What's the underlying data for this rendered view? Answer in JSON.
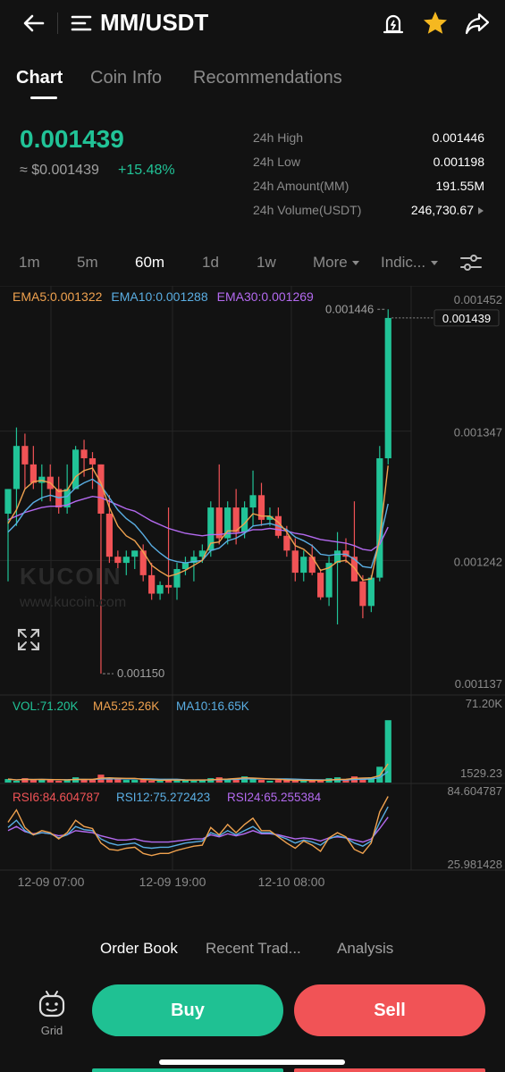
{
  "header": {
    "title": "MM/USDT"
  },
  "tabs": [
    {
      "label": "Chart",
      "active": true
    },
    {
      "label": "Coin Info",
      "active": false
    },
    {
      "label": "Recommendations",
      "active": false
    }
  ],
  "ticker": {
    "last_price": "0.001439",
    "usd_price": "≈ $0.001439",
    "change": "+15.48%",
    "stats": [
      {
        "label": "24h High",
        "value": "0.001446"
      },
      {
        "label": "24h Low",
        "value": "0.001198"
      },
      {
        "label": "24h Amount(MM)",
        "value": "191.55M"
      },
      {
        "label": "24h Volume(USDT)",
        "value": "246,730.67"
      }
    ]
  },
  "intervals": [
    {
      "label": "1m",
      "active": false
    },
    {
      "label": "5m",
      "active": false
    },
    {
      "label": "60m",
      "active": true
    },
    {
      "label": "1d",
      "active": false
    },
    {
      "label": "1w",
      "active": false
    },
    {
      "label": "More",
      "active": false
    },
    {
      "label": "Indic...",
      "active": false
    }
  ],
  "legend": {
    "ema5": "EMA5:0.001322",
    "ema10": "EMA10:0.001288",
    "ema30": "EMA30:0.001269",
    "vol": "VOL:71.20K",
    "ma5": "MA5:25.26K",
    "ma10": "MA10:16.65K",
    "rsi6": "RSI6:84.604787",
    "rsi12": "RSI12:75.272423",
    "rsi24": "RSI24:65.255384"
  },
  "watermark": {
    "brand": "KUCOIN",
    "url": "www.kucoin.com"
  },
  "bottom_tabs": [
    {
      "label": "Order Book",
      "active": true
    },
    {
      "label": "Recent Trad...",
      "active": false
    },
    {
      "label": "Analysis",
      "active": false
    }
  ],
  "actions": {
    "grid_label": "Grid",
    "buy": "Buy",
    "sell": "Sell"
  },
  "colors": {
    "up": "#21c397",
    "down": "#f15356",
    "ema5": "#f0a24f",
    "ema10": "#5aaee3",
    "ema30": "#b46af0"
  },
  "chart_data": {
    "type": "candlestick",
    "price_axis_ticks": [
      "0.001452",
      "0.001347",
      "0.001242",
      "0.001137"
    ],
    "price_range": [
      0.001137,
      0.001452
    ],
    "current_price_label": "0.001439",
    "high_marker": "0.001446",
    "low_marker": "0.001150",
    "volume_axis_ticks": [
      "71.20K",
      "1529.23"
    ],
    "volume_range": [
      1529.23,
      71200
    ],
    "rsi_axis_ticks": [
      "84.604787",
      "25.981428"
    ],
    "rsi_range": [
      25.981428,
      84.604787
    ],
    "time_labels": [
      "12-09 07:00",
      "12-09 19:00",
      "12-10 08:00"
    ],
    "candles": [
      {
        "o": 0.00128,
        "h": 0.0013,
        "l": 0.001225,
        "c": 0.0013
      },
      {
        "o": 0.0013,
        "h": 0.00135,
        "l": 0.00127,
        "c": 0.001335
      },
      {
        "o": 0.001335,
        "h": 0.001345,
        "l": 0.0013,
        "c": 0.00132
      },
      {
        "o": 0.00132,
        "h": 0.001335,
        "l": 0.0013,
        "c": 0.001305
      },
      {
        "o": 0.001305,
        "h": 0.00132,
        "l": 0.00129,
        "c": 0.00131
      },
      {
        "o": 0.00131,
        "h": 0.00132,
        "l": 0.00129,
        "c": 0.0013
      },
      {
        "o": 0.0013,
        "h": 0.00131,
        "l": 0.00128,
        "c": 0.001285
      },
      {
        "o": 0.001285,
        "h": 0.00132,
        "l": 0.00128,
        "c": 0.0013
      },
      {
        "o": 0.0013,
        "h": 0.001335,
        "l": 0.0013,
        "c": 0.001332
      },
      {
        "o": 0.001332,
        "h": 0.00134,
        "l": 0.00131,
        "c": 0.001325
      },
      {
        "o": 0.001325,
        "h": 0.00133,
        "l": 0.0013,
        "c": 0.00132
      },
      {
        "o": 0.00132,
        "h": 0.00132,
        "l": 0.00115,
        "c": 0.00128
      },
      {
        "o": 0.00128,
        "h": 0.001295,
        "l": 0.00124,
        "c": 0.001245
      },
      {
        "o": 0.001245,
        "h": 0.00125,
        "l": 0.001225,
        "c": 0.00124
      },
      {
        "o": 0.00124,
        "h": 0.00125,
        "l": 0.00123,
        "c": 0.001245
      },
      {
        "o": 0.001245,
        "h": 0.00125,
        "l": 0.001235,
        "c": 0.00125
      },
      {
        "o": 0.00125,
        "h": 0.001255,
        "l": 0.001225,
        "c": 0.00123
      },
      {
        "o": 0.00123,
        "h": 0.00124,
        "l": 0.00121,
        "c": 0.001215
      },
      {
        "o": 0.001215,
        "h": 0.001225,
        "l": 0.00121,
        "c": 0.001222
      },
      {
        "o": 0.001222,
        "h": 0.001285,
        "l": 0.001215,
        "c": 0.00122
      },
      {
        "o": 0.00122,
        "h": 0.00124,
        "l": 0.00121,
        "c": 0.001235
      },
      {
        "o": 0.001235,
        "h": 0.001245,
        "l": 0.00123,
        "c": 0.00124
      },
      {
        "o": 0.00124,
        "h": 0.00125,
        "l": 0.001225,
        "c": 0.001245
      },
      {
        "o": 0.001245,
        "h": 0.001255,
        "l": 0.00124,
        "c": 0.00125
      },
      {
        "o": 0.00125,
        "h": 0.00129,
        "l": 0.001245,
        "c": 0.001285
      },
      {
        "o": 0.001285,
        "h": 0.00132,
        "l": 0.001255,
        "c": 0.00126
      },
      {
        "o": 0.00126,
        "h": 0.00129,
        "l": 0.001255,
        "c": 0.001285
      },
      {
        "o": 0.001285,
        "h": 0.0013,
        "l": 0.001255,
        "c": 0.001265
      },
      {
        "o": 0.001265,
        "h": 0.00129,
        "l": 0.00126,
        "c": 0.001285
      },
      {
        "o": 0.001285,
        "h": 0.001315,
        "l": 0.00127,
        "c": 0.001295
      },
      {
        "o": 0.001295,
        "h": 0.001305,
        "l": 0.00127,
        "c": 0.001275
      },
      {
        "o": 0.001275,
        "h": 0.001285,
        "l": 0.00127,
        "c": 0.001278
      },
      {
        "o": 0.001278,
        "h": 0.001285,
        "l": 0.00126,
        "c": 0.001262
      },
      {
        "o": 0.001262,
        "h": 0.00127,
        "l": 0.001245,
        "c": 0.00125
      },
      {
        "o": 0.00125,
        "h": 0.00126,
        "l": 0.001225,
        "c": 0.001232
      },
      {
        "o": 0.001232,
        "h": 0.00125,
        "l": 0.001225,
        "c": 0.001245
      },
      {
        "o": 0.001245,
        "h": 0.001255,
        "l": 0.00123,
        "c": 0.001232
      },
      {
        "o": 0.001232,
        "h": 0.001235,
        "l": 0.00121,
        "c": 0.001212
      },
      {
        "o": 0.001212,
        "h": 0.001245,
        "l": 0.001205,
        "c": 0.00124
      },
      {
        "o": 0.00124,
        "h": 0.001265,
        "l": 0.00119,
        "c": 0.00125
      },
      {
        "o": 0.00125,
        "h": 0.00126,
        "l": 0.00124,
        "c": 0.001245
      },
      {
        "o": 0.001245,
        "h": 0.00129,
        "l": 0.001225,
        "c": 0.001225
      },
      {
        "o": 0.001225,
        "h": 0.00123,
        "l": 0.001195,
        "c": 0.001205
      },
      {
        "o": 0.001205,
        "h": 0.00123,
        "l": 0.0012,
        "c": 0.001228
      },
      {
        "o": 0.001228,
        "h": 0.001335,
        "l": 0.001225,
        "c": 0.001325
      },
      {
        "o": 0.001325,
        "h": 0.001446,
        "l": 0.00132,
        "c": 0.001439
      }
    ],
    "volume": [
      4,
      2,
      5,
      3,
      4,
      3,
      2,
      3,
      6,
      4,
      3,
      9,
      5,
      4,
      3,
      3,
      3,
      2,
      2,
      4,
      3,
      3,
      2,
      3,
      5,
      6,
      4,
      5,
      7,
      4,
      3,
      2,
      3,
      3,
      2,
      2,
      2,
      3,
      5,
      6,
      3,
      7,
      5,
      6,
      18,
      71
    ],
    "ema5": [
      0.001272,
      0.001283,
      0.0013,
      0.001306,
      0.001307,
      0.001305,
      0.001298,
      0.001299,
      0.00131,
      0.001315,
      0.001317,
      0.001305,
      0.001285,
      0.00127,
      0.001262,
      0.001258,
      0.001249,
      0.001238,
      0.001233,
      0.001229,
      0.001231,
      0.001234,
      0.001238,
      0.001242,
      0.001256,
      0.001257,
      0.001266,
      0.001266,
      0.001272,
      0.00128,
      0.001278,
      0.001278,
      0.001273,
      0.001265,
      0.001254,
      0.001251,
      0.001245,
      0.001234,
      0.001236,
      0.001241,
      0.001242,
      0.001236,
      0.001226,
      0.001227,
      0.00126,
      0.001319
    ],
    "ema10": [
      0.001265,
      0.001272,
      0.001282,
      0.001289,
      0.001293,
      0.001295,
      0.001293,
      0.001294,
      0.001301,
      0.001305,
      0.001308,
      0.001303,
      0.001293,
      0.001283,
      0.001276,
      0.001271,
      0.001263,
      0.001254,
      0.001248,
      0.001243,
      0.001241,
      0.00124,
      0.001241,
      0.001242,
      0.00125,
      0.001252,
      0.001258,
      0.00126,
      0.001264,
      0.00127,
      0.001271,
      0.001272,
      0.00127,
      0.001267,
      0.001261,
      0.001258,
      0.001254,
      0.001247,
      0.001246,
      0.001247,
      0.001247,
      0.001243,
      0.001237,
      0.001236,
      0.001258,
      0.001288
    ],
    "ema30": [
      0.001275,
      0.001278,
      0.001281,
      0.001283,
      0.001285,
      0.001286,
      0.001286,
      0.001287,
      0.00129,
      0.001292,
      0.001294,
      0.001293,
      0.00129,
      0.001287,
      0.001284,
      0.001282,
      0.001278,
      0.001274,
      0.001271,
      0.001268,
      0.001266,
      0.001264,
      0.001263,
      0.001262,
      0.001263,
      0.001263,
      0.001264,
      0.001264,
      0.001265,
      0.001267,
      0.001267,
      0.001268,
      0.001267,
      0.001266,
      0.001264,
      0.001263,
      0.001261,
      0.001259,
      0.001258,
      0.001257,
      0.001256,
      0.001254,
      0.001251,
      0.00125,
      0.001255,
      0.001269
    ],
    "rsi6": [
      60,
      72,
      55,
      48,
      52,
      50,
      44,
      50,
      62,
      56,
      54,
      40,
      34,
      33,
      35,
      36,
      30,
      28,
      30,
      30,
      33,
      35,
      37,
      38,
      55,
      48,
      58,
      50,
      58,
      64,
      52,
      52,
      46,
      40,
      35,
      42,
      38,
      32,
      45,
      50,
      46,
      34,
      30,
      40,
      70,
      85
    ],
    "rsi12": [
      55,
      62,
      52,
      48,
      50,
      49,
      45,
      48,
      56,
      53,
      52,
      44,
      40,
      38,
      39,
      40,
      36,
      35,
      36,
      36,
      38,
      40,
      41,
      42,
      50,
      47,
      52,
      48,
      52,
      56,
      50,
      50,
      47,
      44,
      40,
      43,
      41,
      38,
      44,
      47,
      45,
      40,
      37,
      42,
      60,
      75
    ],
    "rsi24": [
      52,
      56,
      51,
      49,
      50,
      49,
      47,
      48,
      52,
      51,
      50,
      47,
      45,
      43,
      43,
      44,
      42,
      41,
      41,
      41,
      42,
      43,
      44,
      44,
      48,
      46,
      49,
      47,
      49,
      52,
      49,
      49,
      48,
      46,
      44,
      45,
      44,
      42,
      45,
      46,
      45,
      43,
      41,
      44,
      54,
      65
    ]
  }
}
